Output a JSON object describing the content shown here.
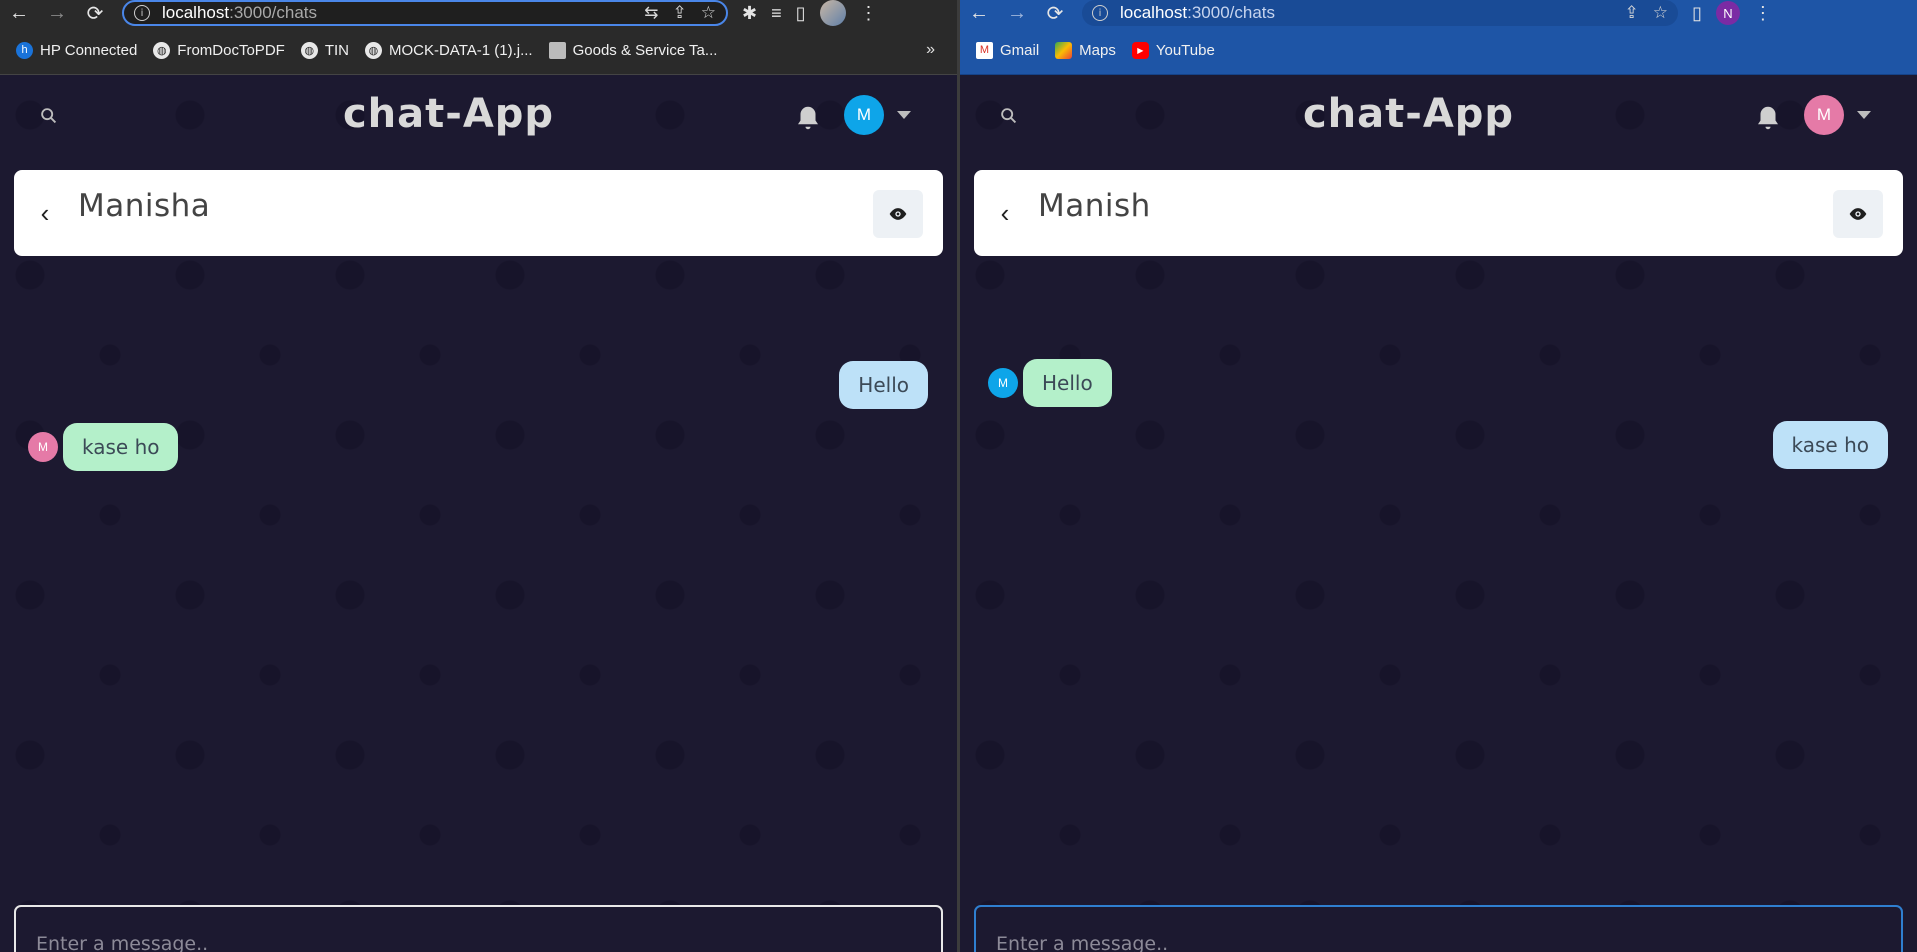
{
  "left": {
    "url_host": "localhost",
    "url_path": ":3000/chats",
    "bookmarks": [
      {
        "label": "HP Connected",
        "icon": "hp-icon"
      },
      {
        "label": "FromDocToPDF",
        "icon": "globe-icon"
      },
      {
        "label": "TIN",
        "icon": "globe-icon"
      },
      {
        "label": "MOCK-DATA-1 (1).j...",
        "icon": "globe-icon"
      },
      {
        "label": "Goods & Service Ta...",
        "icon": "page-icon"
      }
    ],
    "bookmarks_more": "»",
    "app_title": "chat-App",
    "user_avatar_letter": "M",
    "user_avatar_color": "#0ea5e9",
    "chat_name": "Manisha",
    "messages": [
      {
        "text": "Hello",
        "side": "right",
        "type": "mine"
      },
      {
        "text": "kase ho",
        "side": "left",
        "type": "theirs",
        "avatar": "M",
        "avatar_color": "#e57aa7"
      }
    ],
    "input_placeholder": "Enter a message.."
  },
  "right": {
    "url_host": "localhost",
    "url_path": ":3000/chats",
    "profile_letter": "N",
    "bookmarks": [
      {
        "label": "Gmail",
        "icon": "gmail-icon"
      },
      {
        "label": "Maps",
        "icon": "maps-icon"
      },
      {
        "label": "YouTube",
        "icon": "youtube-icon"
      }
    ],
    "app_title": "chat-App",
    "user_avatar_letter": "M",
    "user_avatar_color": "#e57aa7",
    "chat_name": "Manish",
    "messages": [
      {
        "text": "Hello",
        "side": "left",
        "type": "theirs",
        "avatar": "M",
        "avatar_color": "#0ea5e9"
      },
      {
        "text": "kase ho",
        "side": "right",
        "type": "mine"
      }
    ],
    "input_placeholder": "Enter a message.."
  }
}
